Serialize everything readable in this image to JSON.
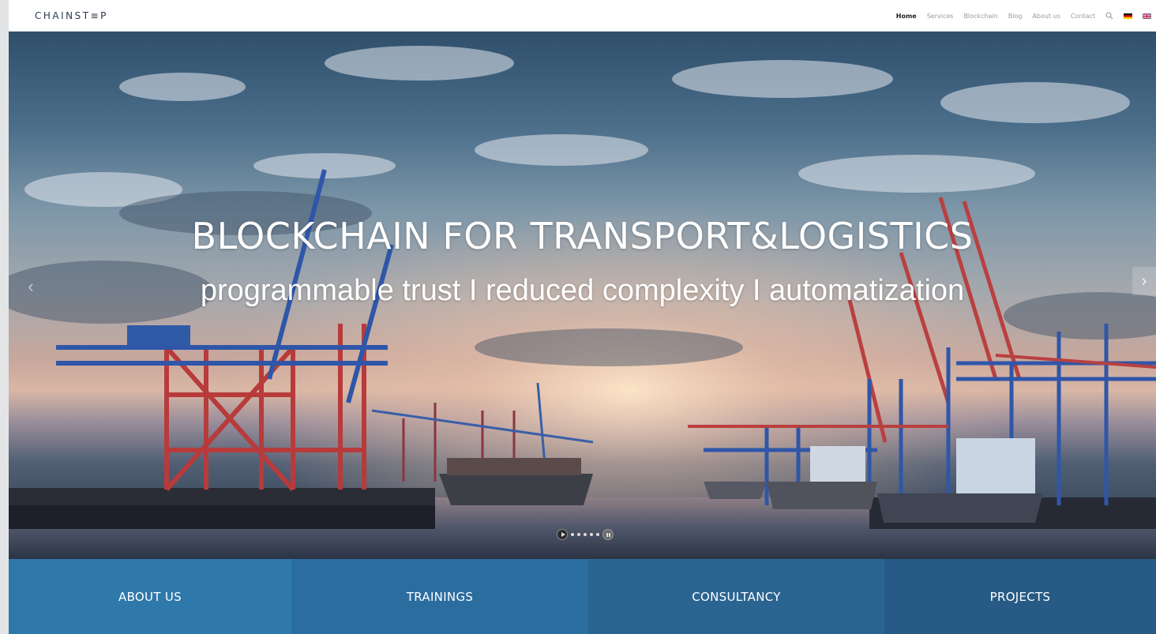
{
  "header": {
    "logo": "CHAINST≡P",
    "nav": [
      "Home",
      "Services",
      "Blockchain",
      "Blog",
      "About us",
      "Contact"
    ],
    "active_nav": "Home",
    "search_icon": "search-icon",
    "flags": [
      "german-flag-icon",
      "uk-flag-icon"
    ]
  },
  "hero": {
    "title": "BLOCKCHAIN FOR TRANSPORT&LOGISTICS",
    "subtitle": "programmable trust I reduced complexity I automatization",
    "prev_arrow": "‹",
    "next_arrow": "›",
    "slides_count": 5,
    "active_slide": 1
  },
  "tiles": [
    "ABOUT US",
    "TRAININGS",
    "CONSULTANCY",
    "PROJECTS"
  ],
  "colors": {
    "tile_1": "#2f78aa",
    "tile_2": "#2c6d9f",
    "tile_3": "#2a6592",
    "tile_4": "#275b85",
    "header_bg": "#ffffff"
  }
}
